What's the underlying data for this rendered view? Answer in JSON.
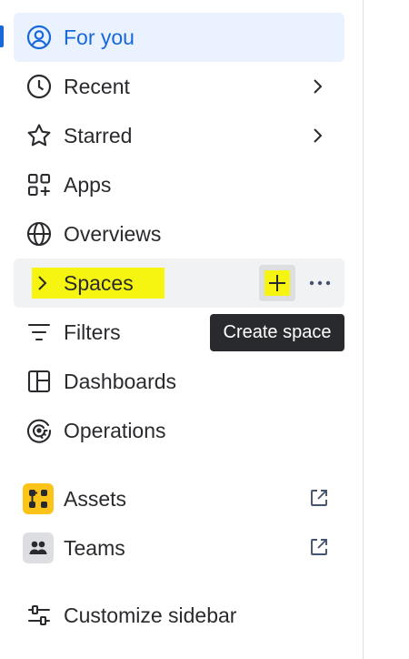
{
  "sidebar": {
    "items": [
      {
        "label": "For you",
        "icon": "user-circle-icon",
        "active": true
      },
      {
        "label": "Recent",
        "icon": "clock-icon"
      },
      {
        "label": "Starred",
        "icon": "star-icon"
      },
      {
        "label": "Apps",
        "icon": "apps-grid-icon"
      },
      {
        "label": "Overviews",
        "icon": "globe-icon"
      },
      {
        "label": "Spaces",
        "icon": "chevron-right-icon",
        "highlighted": true
      },
      {
        "label": "Filters",
        "icon": "filter-icon"
      },
      {
        "label": "Dashboards",
        "icon": "dashboard-icon"
      },
      {
        "label": "Operations",
        "icon": "operations-icon"
      },
      {
        "label": "Assets",
        "icon": "assets-icon",
        "external": true
      },
      {
        "label": "Teams",
        "icon": "teams-icon",
        "external": true
      },
      {
        "label": "Customize sidebar",
        "icon": "sliders-icon"
      }
    ]
  },
  "tooltip": {
    "text": "Create space"
  },
  "colors": {
    "accent": "#1868db",
    "active_bg": "#e9f2fe",
    "highlight": "#f5f511",
    "assets_badge": "#fcc318",
    "teams_badge": "#dddee1",
    "tooltip_bg": "#292a2e"
  }
}
